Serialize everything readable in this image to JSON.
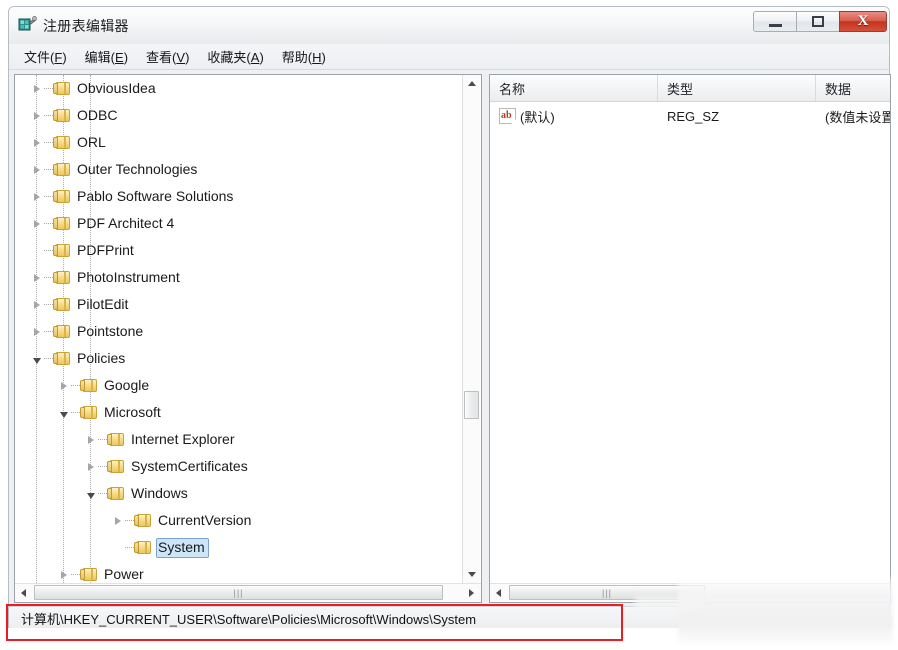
{
  "window": {
    "title": "注册表编辑器",
    "app_icon": "registry-editor-icon",
    "controls": {
      "minimize_label": "最小化",
      "maximize_label": "最大化",
      "close_label": "X"
    }
  },
  "menubar": {
    "items": [
      {
        "label": "文件",
        "accel": "F"
      },
      {
        "label": "编辑",
        "accel": "E"
      },
      {
        "label": "查看",
        "accel": "V"
      },
      {
        "label": "收藏夹",
        "accel": "A"
      },
      {
        "label": "帮助",
        "accel": "H"
      }
    ]
  },
  "tree": {
    "nodes": [
      {
        "label": "ObviousIdea",
        "depth": 2,
        "state": "collapsed"
      },
      {
        "label": "ODBC",
        "depth": 2,
        "state": "collapsed"
      },
      {
        "label": "ORL",
        "depth": 2,
        "state": "collapsed"
      },
      {
        "label": "Outer Technologies",
        "depth": 2,
        "state": "collapsed"
      },
      {
        "label": "Pablo Software Solutions",
        "depth": 2,
        "state": "collapsed"
      },
      {
        "label": "PDF Architect 4",
        "depth": 2,
        "state": "collapsed"
      },
      {
        "label": "PDFPrint",
        "depth": 2,
        "state": "leaf"
      },
      {
        "label": "PhotoInstrument",
        "depth": 2,
        "state": "collapsed"
      },
      {
        "label": "PilotEdit",
        "depth": 2,
        "state": "collapsed"
      },
      {
        "label": "Pointstone",
        "depth": 2,
        "state": "collapsed"
      },
      {
        "label": "Policies",
        "depth": 2,
        "state": "expanded"
      },
      {
        "label": "Google",
        "depth": 3,
        "state": "collapsed"
      },
      {
        "label": "Microsoft",
        "depth": 3,
        "state": "expanded"
      },
      {
        "label": "Internet Explorer",
        "depth": 4,
        "state": "collapsed"
      },
      {
        "label": "SystemCertificates",
        "depth": 4,
        "state": "collapsed"
      },
      {
        "label": "Windows",
        "depth": 4,
        "state": "expanded"
      },
      {
        "label": "CurrentVersion",
        "depth": 5,
        "state": "collapsed"
      },
      {
        "label": "System",
        "depth": 5,
        "state": "leaf",
        "selected": true
      },
      {
        "label": "Power",
        "depth": 3,
        "state": "collapsed"
      }
    ],
    "scrollbar": {
      "up_arrow": "scroll-up-arrow",
      "down_arrow": "scroll-down-arrow",
      "left_arrow": "scroll-left-arrow",
      "right_arrow": "scroll-right-arrow"
    }
  },
  "list": {
    "columns": [
      {
        "label": "名称"
      },
      {
        "label": "类型"
      },
      {
        "label": "数据"
      }
    ],
    "rows": [
      {
        "icon": "string-value-icon",
        "name": "(默认)",
        "type": "REG_SZ",
        "data": "(数值未设置"
      }
    ]
  },
  "statusbar": {
    "path": "计算机\\HKEY_CURRENT_USER\\Software\\Policies\\Microsoft\\Windows\\System"
  },
  "annotation": {
    "color": "#ec1c24",
    "target": "statusbar-path"
  },
  "colors": {
    "selection_fill": "#cde6f7",
    "selection_border": "#7da2ce",
    "folder_gold": "#ecc75c",
    "close_red": "#c23420",
    "annotation_red": "#ec1c24"
  }
}
